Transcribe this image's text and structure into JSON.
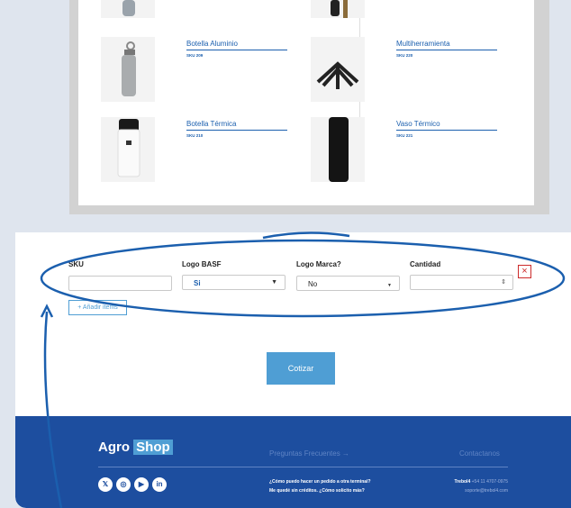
{
  "products": [
    {
      "name": "Botella Aluminio",
      "sku": "SKU 209"
    },
    {
      "name": "Multiherramienta",
      "sku": "SKU 220"
    },
    {
      "name": "Botella Térmica",
      "sku": "SKU 210"
    },
    {
      "name": "Vaso Térmico",
      "sku": "SKU 221"
    }
  ],
  "form": {
    "labels": {
      "sku": "SKU",
      "logo_basf": "Logo BASF",
      "logo_marca": "Logo Marca?",
      "cantidad": "Cantidad"
    },
    "sku_value": "",
    "logo_basf_value": "Si",
    "logo_marca_value": "No",
    "cantidad_value": "",
    "remove_label": "×",
    "add_label": "+ Añadir items",
    "submit_label": "Cotizar"
  },
  "footer": {
    "logo_agro": "Agro",
    "logo_shop": "Shop",
    "faq_title": "Preguntas Frecuentes →",
    "contact_title": "Contactanos",
    "faq_items": [
      "¿Cómo puedo hacer un pedido a otra terminal?",
      "Me quedé sin créditos. ¿Cómo solicito más?"
    ],
    "contact_name": "Trebol4",
    "contact_phone": "+54 11 4707-0975",
    "contact_email": "soporte@trebol4.com",
    "social_icons": [
      "x-icon",
      "instagram-icon",
      "youtube-icon",
      "linkedin-icon"
    ]
  },
  "colors": {
    "accent": "#4f9ed4",
    "footer": "#1d4e9f",
    "annotation": "#1b5fae",
    "remove": "#cc2b2b"
  }
}
